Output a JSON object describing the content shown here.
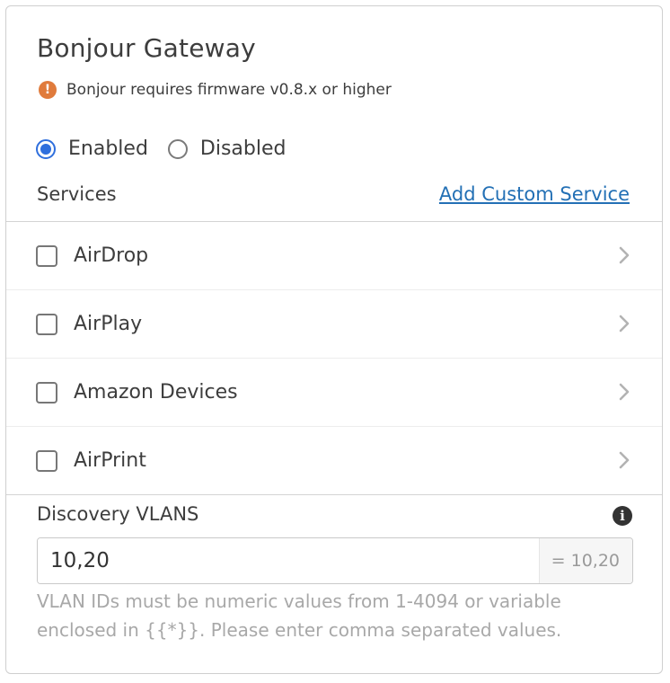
{
  "panel": {
    "title": "Bonjour Gateway",
    "warning": {
      "icon": "warning-exclamation-icon",
      "text": "Bonjour requires firmware v0.8.x or higher",
      "color": "#e07b3c"
    }
  },
  "mode": {
    "options": [
      {
        "label": "Enabled",
        "selected": true
      },
      {
        "label": "Disabled",
        "selected": false
      }
    ],
    "accent_color": "#2f6fdd"
  },
  "services": {
    "label": "Services",
    "add_link": "Add Custom Service",
    "link_color": "#2370b5",
    "items": [
      {
        "label": "AirDrop",
        "checked": false
      },
      {
        "label": "AirPlay",
        "checked": false
      },
      {
        "label": "Amazon Devices",
        "checked": false
      },
      {
        "label": "AirPrint",
        "checked": false
      }
    ]
  },
  "discovery": {
    "label": "Discovery VLANS",
    "info_icon": "info-icon",
    "value": "10,20",
    "resolved": "= 10,20",
    "help": "VLAN IDs must be numeric values from 1-4094 or variable enclosed in {{*}}. Please enter comma separated values."
  }
}
